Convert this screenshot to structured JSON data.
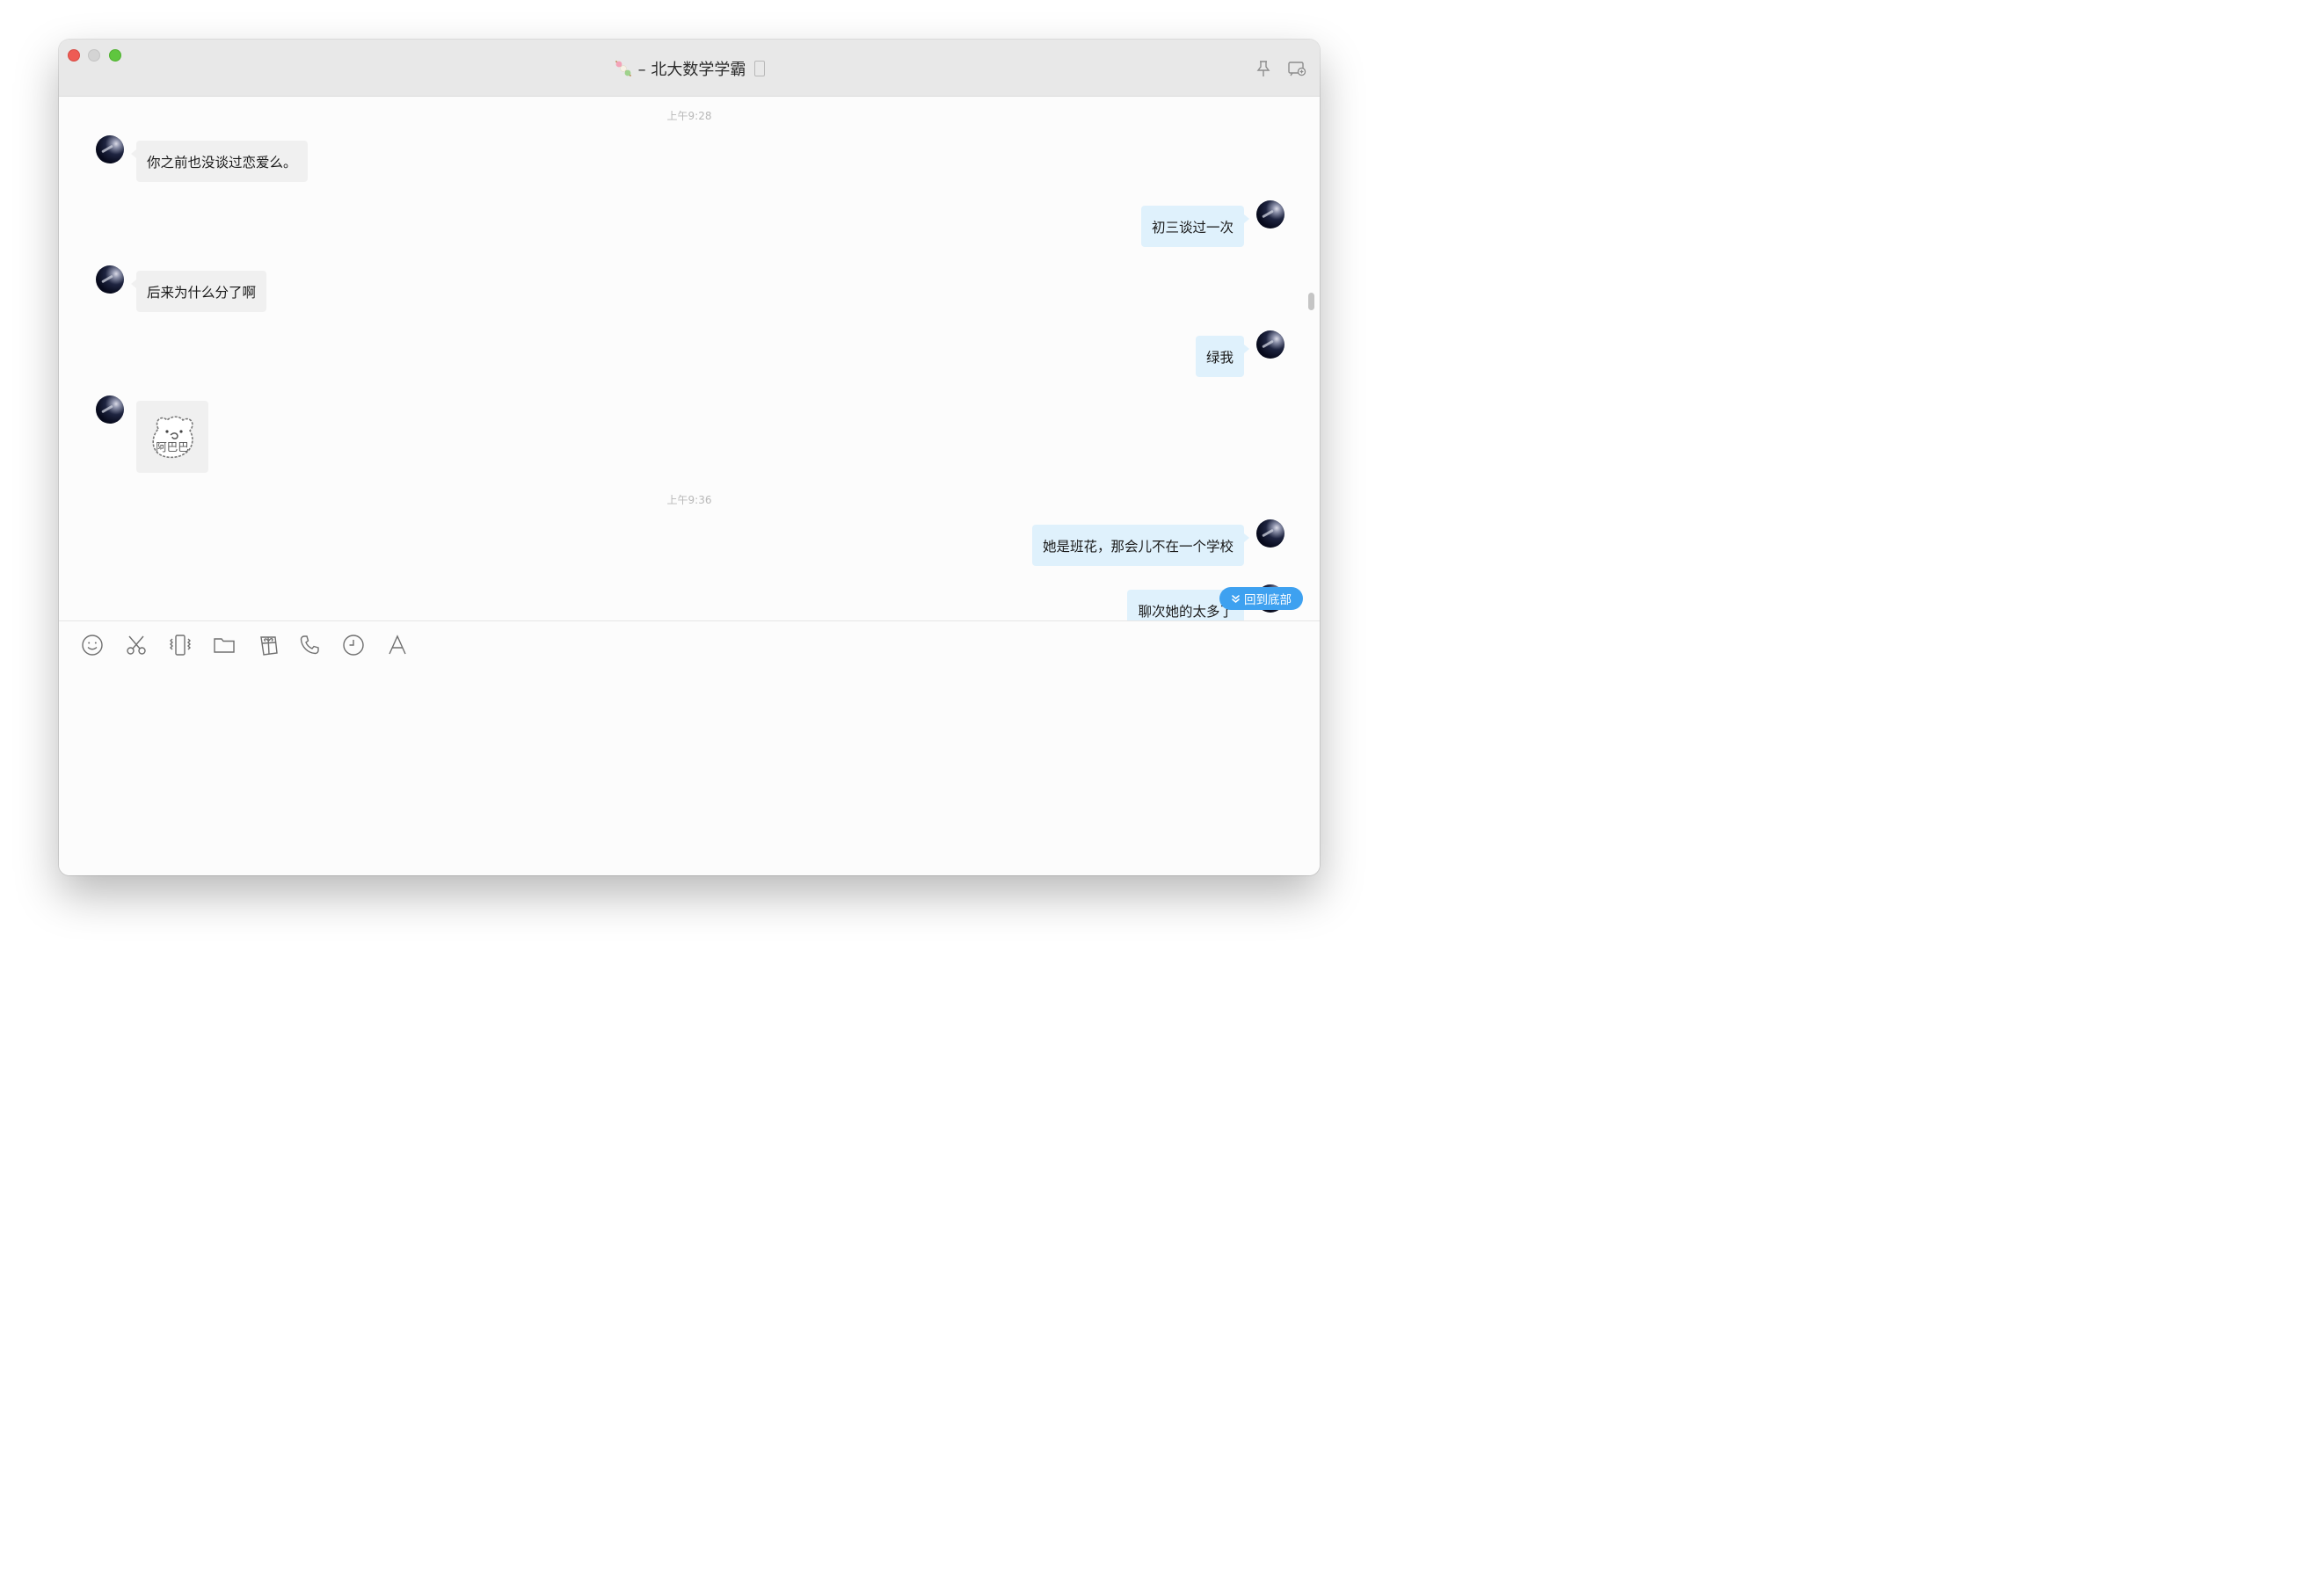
{
  "window": {
    "title": "– 北大数学学霸"
  },
  "icons": {
    "title_emoji": "dango-skewer-icon",
    "title_device": "phone-icon",
    "toolbar_right": [
      "pin-icon",
      "add-window-icon"
    ],
    "composer_tools": [
      "emoji-icon",
      "scissors-icon",
      "vibrate-icon",
      "folder-icon",
      "gift-icon",
      "phone-call-icon",
      "clock-icon",
      "font-icon"
    ]
  },
  "colors": {
    "incoming_bubble": "#f0f0f0",
    "outgoing_bubble": "#dff1fc",
    "accent": "#3ea1f0"
  },
  "messages": {
    "ts1": "上午9:28",
    "m1": "你之前也没谈过恋爱么。",
    "m2": "初三谈过一次",
    "m3": "后来为什么分了啊",
    "m4": "绿我",
    "m5_sticker_text": "阿巴巴",
    "ts2": "上午9:36",
    "m6": "她是班花，那会儿不在一个学校",
    "m7": "聊次她的太多了"
  },
  "chat": {
    "back_to_bottom": "回到底部"
  }
}
